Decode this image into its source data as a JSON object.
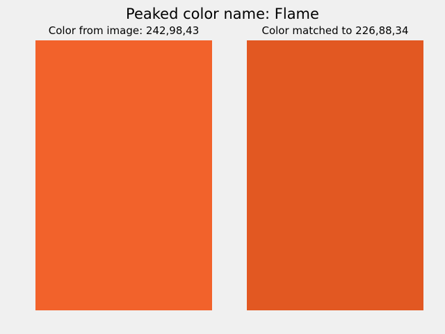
{
  "figure": {
    "suptitle": "Peaked color name: Flame"
  },
  "panels": [
    {
      "title": "Color from image: 242,98,43",
      "color": "#f2622b"
    },
    {
      "title": "Color matched to 226,88,34",
      "color": "#e25822"
    }
  ],
  "background_color": "#f0f0f0"
}
